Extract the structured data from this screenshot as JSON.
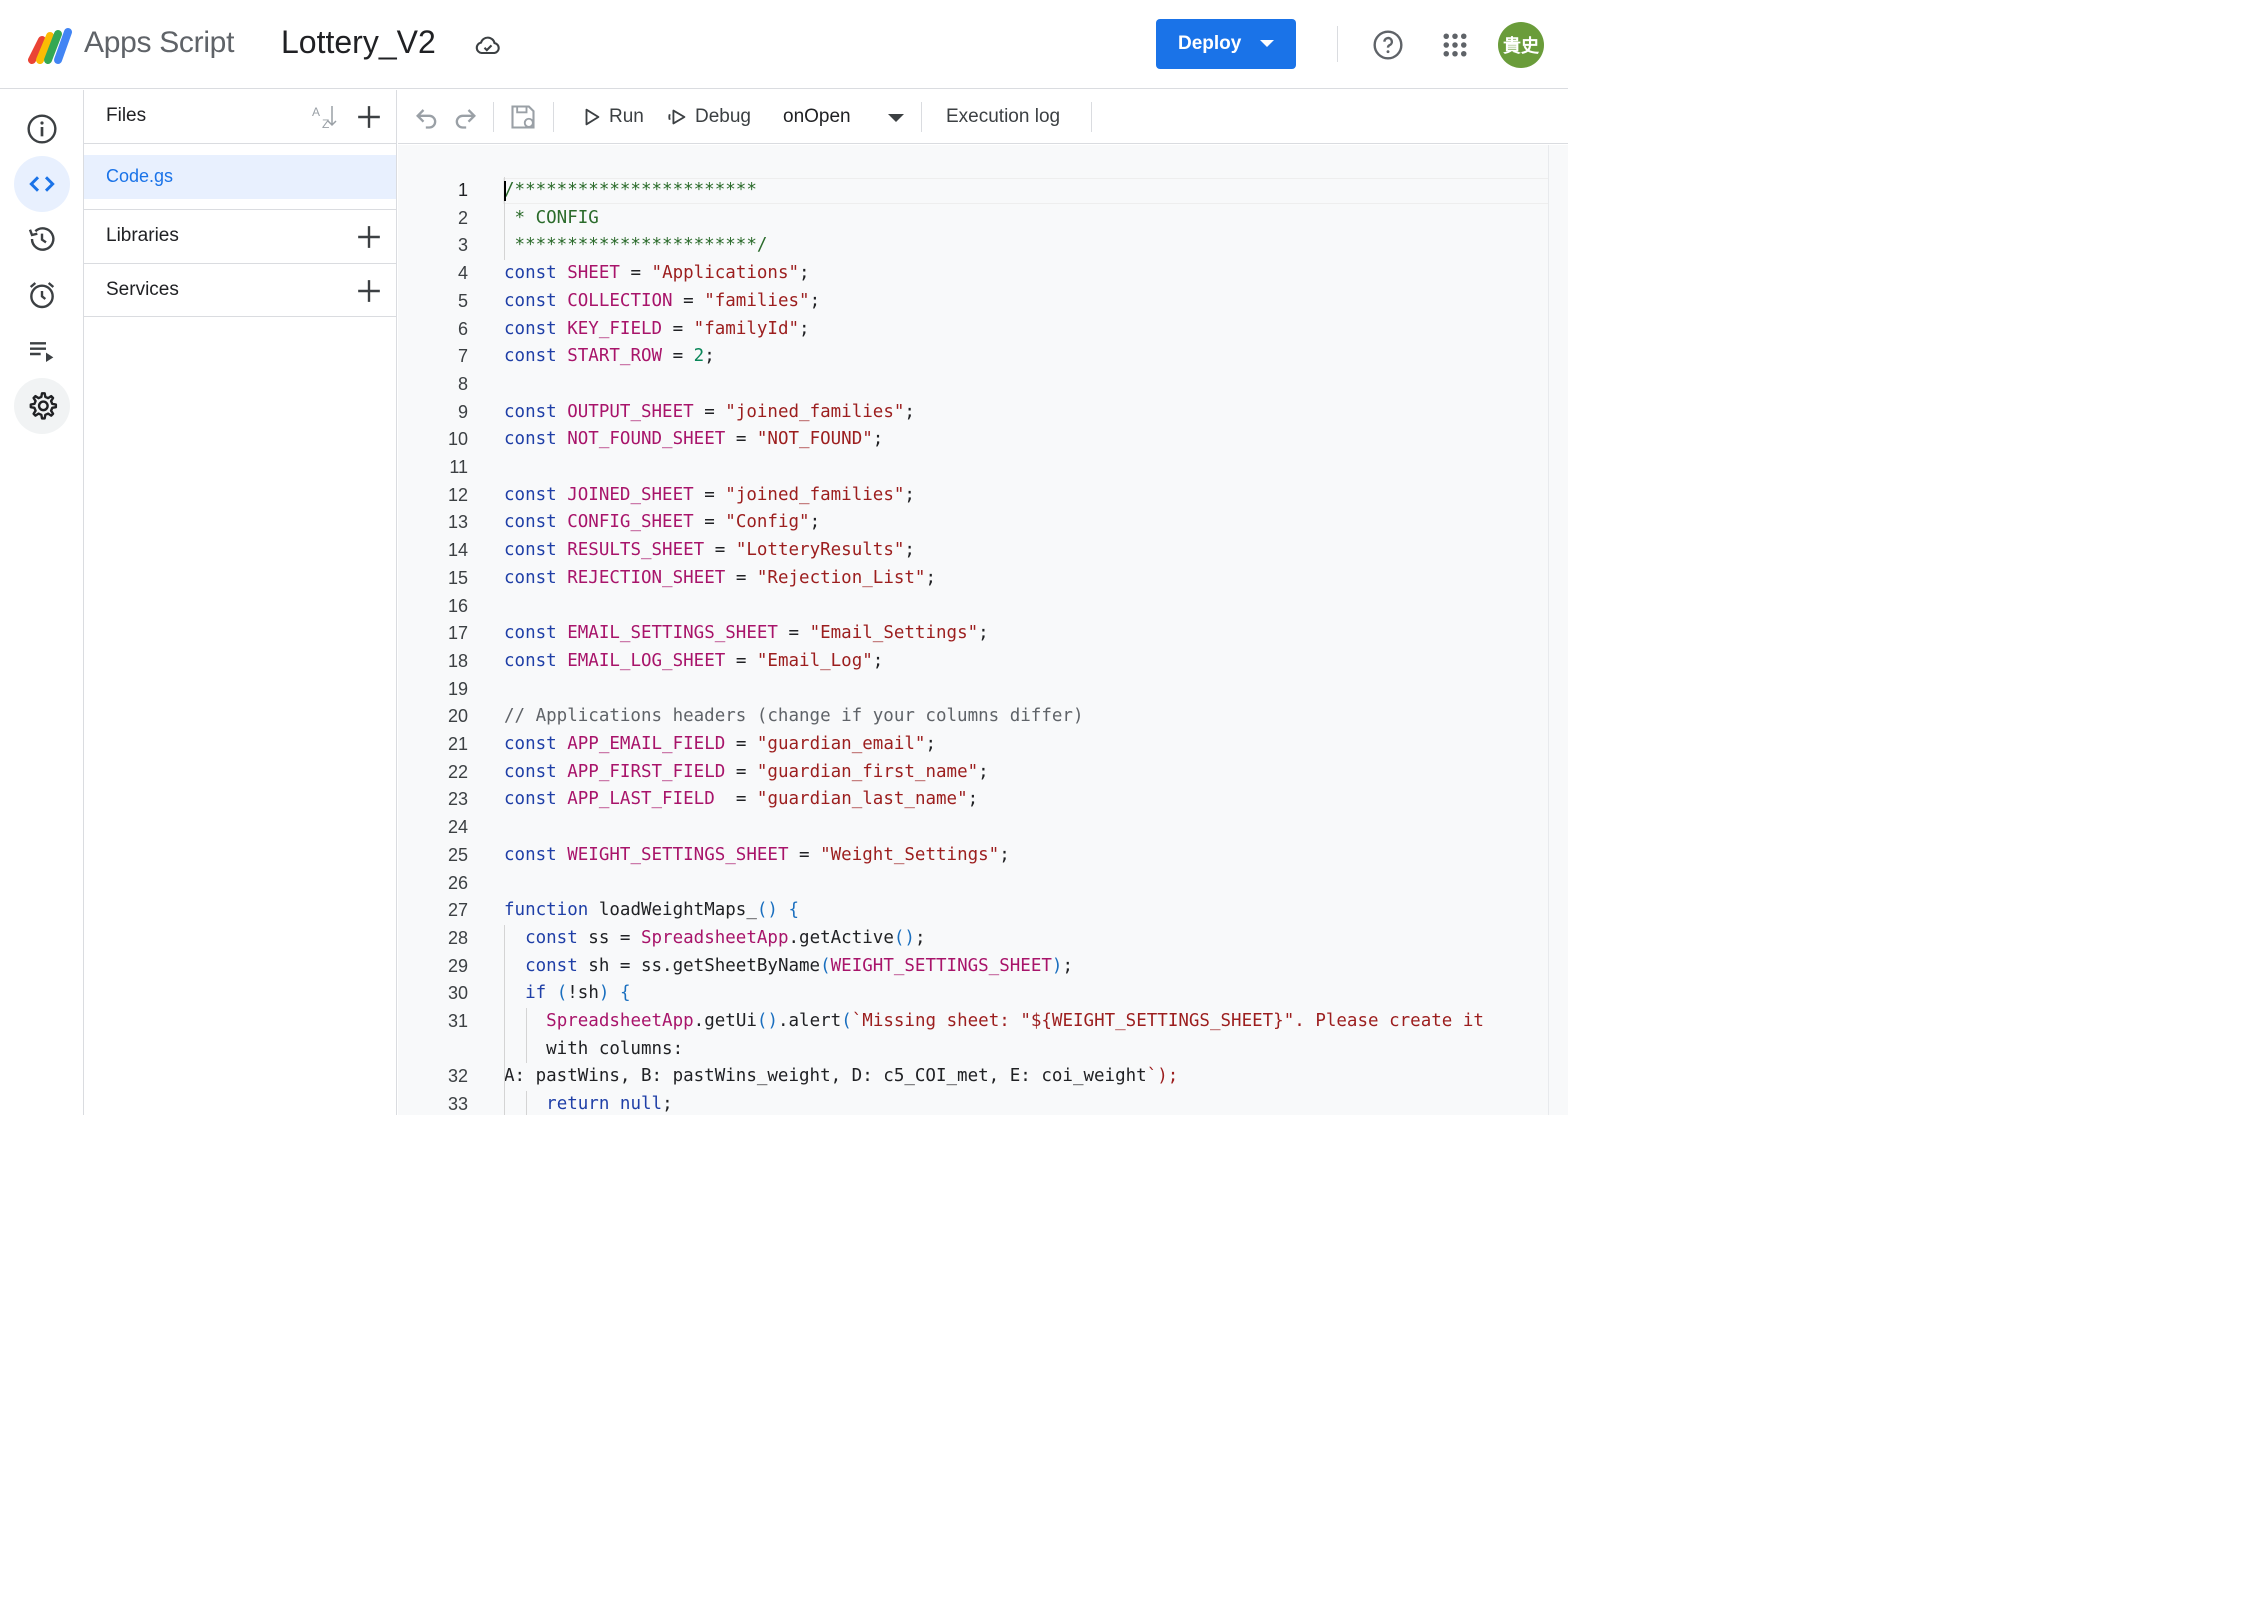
{
  "header": {
    "app_name": "Apps Script",
    "project_title": "Lottery_V2",
    "deploy_label": "Deploy",
    "avatar_text": "貴史"
  },
  "rail": {
    "items": [
      "info-icon",
      "code-icon",
      "history-icon",
      "alarm-icon",
      "executions-icon",
      "settings-icon"
    ],
    "active": "code-icon"
  },
  "files_panel": {
    "title": "Files",
    "files": [
      "Code.gs"
    ],
    "libraries_label": "Libraries",
    "services_label": "Services"
  },
  "toolbar": {
    "run_label": "Run",
    "debug_label": "Debug",
    "function_selected": "onOpen",
    "execution_log_label": "Execution log"
  },
  "colors": {
    "accent": "#1a73e8",
    "avatar": "#6a9c3a",
    "selected_file_bg": "#e8f0fe"
  },
  "editor": {
    "lines": [
      {
        "n": "1",
        "t": "/***********************"
      },
      {
        "n": "2",
        "t": " * CONFIG"
      },
      {
        "n": "3",
        "t": " ***********************/"
      },
      {
        "n": "4",
        "t": "const SHEET = \"Applications\";"
      },
      {
        "n": "5",
        "t": "const COLLECTION = \"families\";"
      },
      {
        "n": "6",
        "t": "const KEY_FIELD = \"familyId\";"
      },
      {
        "n": "7",
        "t": "const START_ROW = 2;"
      },
      {
        "n": "8",
        "t": ""
      },
      {
        "n": "9",
        "t": "const OUTPUT_SHEET = \"joined_families\";"
      },
      {
        "n": "10",
        "t": "const NOT_FOUND_SHEET = \"NOT_FOUND\";"
      },
      {
        "n": "11",
        "t": ""
      },
      {
        "n": "12",
        "t": "const JOINED_SHEET = \"joined_families\";"
      },
      {
        "n": "13",
        "t": "const CONFIG_SHEET = \"Config\";"
      },
      {
        "n": "14",
        "t": "const RESULTS_SHEET = \"LotteryResults\";"
      },
      {
        "n": "15",
        "t": "const REJECTION_SHEET = \"Rejection_List\";"
      },
      {
        "n": "16",
        "t": ""
      },
      {
        "n": "17",
        "t": "const EMAIL_SETTINGS_SHEET = \"Email_Settings\";"
      },
      {
        "n": "18",
        "t": "const EMAIL_LOG_SHEET = \"Email_Log\";"
      },
      {
        "n": "19",
        "t": ""
      },
      {
        "n": "20",
        "t": "// Applications headers (change if your columns differ)"
      },
      {
        "n": "21",
        "t": "const APP_EMAIL_FIELD = \"guardian_email\";"
      },
      {
        "n": "22",
        "t": "const APP_FIRST_FIELD = \"guardian_first_name\";"
      },
      {
        "n": "23",
        "t": "const APP_LAST_FIELD  = \"guardian_last_name\";"
      },
      {
        "n": "24",
        "t": ""
      },
      {
        "n": "25",
        "t": "const WEIGHT_SETTINGS_SHEET = \"Weight_Settings\";"
      },
      {
        "n": "26",
        "t": ""
      },
      {
        "n": "27",
        "t": "function loadWeightMaps_() {"
      },
      {
        "n": "28",
        "t": "  const ss = SpreadsheetApp.getActive();"
      },
      {
        "n": "29",
        "t": "  const sh = ss.getSheetByName(WEIGHT_SETTINGS_SHEET);"
      },
      {
        "n": "30",
        "t": "  if (!sh) {"
      },
      {
        "n": "31",
        "t": "    SpreadsheetApp.getUi().alert(`Missing sheet: \"${WEIGHT_SETTINGS_SHEET}\". Please create it"
      },
      {
        "n": "",
        "t": "    with columns:"
      },
      {
        "n": "32",
        "t": "A: pastWins, B: pastWins_weight, D: c5_COI_met, E: coi_weight`);"
      },
      {
        "n": "33",
        "t": "    return null;"
      }
    ]
  }
}
